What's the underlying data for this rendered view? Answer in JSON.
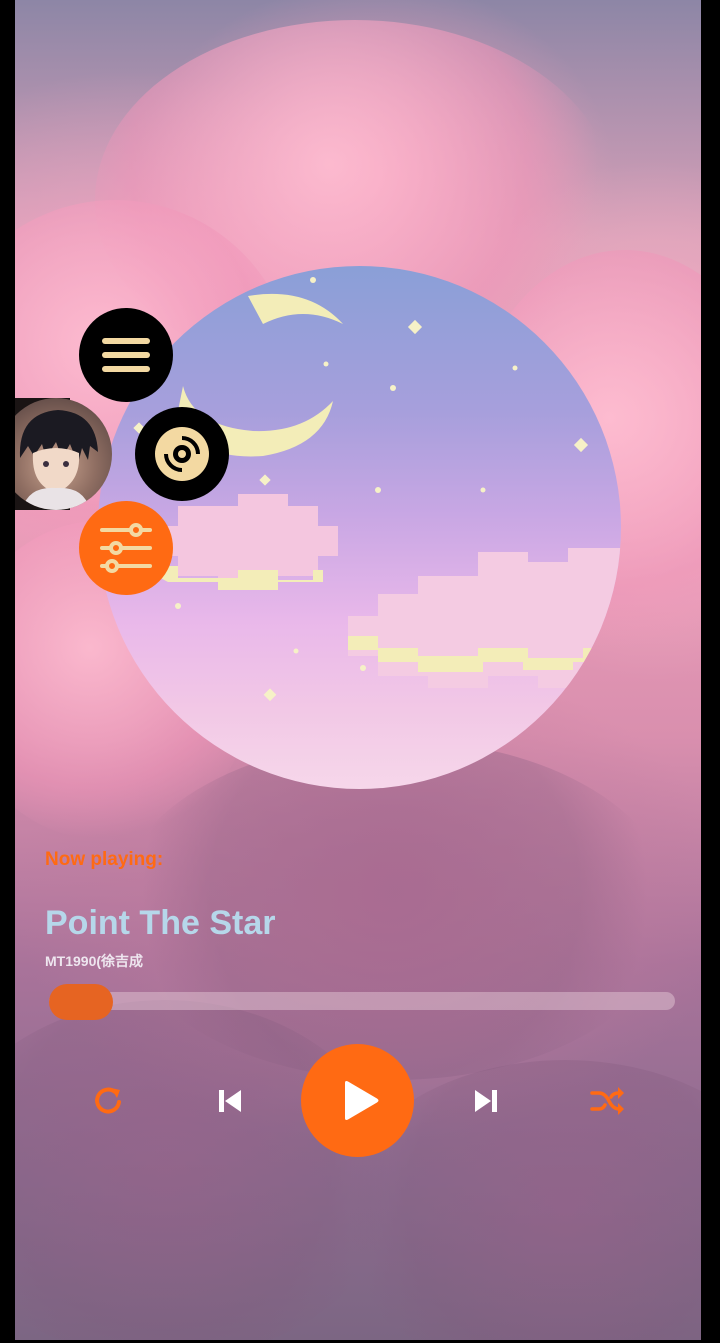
{
  "now_playing_label": "Now playing:",
  "track": {
    "title": "Point The Star",
    "artist": "MT1990(徐吉成"
  },
  "progress": {
    "fraction": 0.1
  },
  "side_buttons": [
    {
      "icon": "menu-icon",
      "color": "#000000"
    },
    {
      "icon": "disc-icon",
      "color": "#000000"
    },
    {
      "icon": "equalizer-icon",
      "color": "#ff6a13"
    }
  ],
  "controls": [
    {
      "icon": "repeat-icon"
    },
    {
      "icon": "previous-icon"
    },
    {
      "icon": "play-icon"
    },
    {
      "icon": "next-icon"
    },
    {
      "icon": "shuffle-icon"
    }
  ],
  "colors": {
    "accent": "#ff6a13",
    "title": "#b6d7ea",
    "progress_fill": "#e66422"
  }
}
